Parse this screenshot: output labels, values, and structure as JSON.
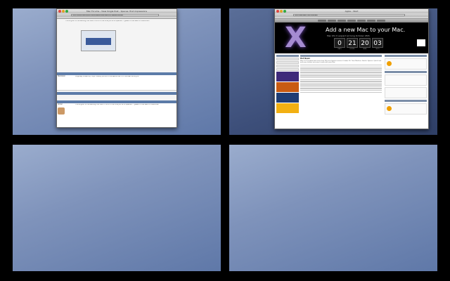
{
  "spaces": [
    {
      "id": "space-1",
      "has_window": true
    },
    {
      "id": "space-2",
      "has_window": true
    },
    {
      "id": "space-3",
      "has_window": false
    },
    {
      "id": "space-4",
      "has_window": false
    }
  ],
  "forum_window": {
    "title": "Mac Forums - View Single Post - Spaces: first impressions",
    "url": "http://forums.macrumors.com/showpost.php?p=4109254&postcount=1",
    "quote_text": "This is good for something, but then in 10% of the time you're on spaces... I guess it'd be best to customize...",
    "post_a_user": "Teckmann",
    "post_a_text": "Originally Posted by Tivyo. Mostly you've to the space that'll it'd be best sorting to.",
    "post_b_user": "rpmac",
    "post_b_text": "This is good for something, but then in 30% of the time you're on spaces... I guess it'd be best to customize."
  },
  "apple_window": {
    "title": "Apple - Start",
    "url": "http://www.apple.com/startpage/",
    "hero_headline": "Add a new Mac to your Mac.",
    "hero_sub": "Mac OS X Leopard arriving October 26th",
    "countdown": [
      "0",
      "21",
      "20",
      "03"
    ],
    "countdown_labels": [
      "DAYS",
      "HOURS",
      "MINS",
      "SECS"
    ],
    "article_title": "Hot News",
    "article_text": "Mac OS X Leopard with more than 300 new features arrives October 26. Time Machine, Stacks, Spaces, Quick Look and more bring a new way to work with your Mac."
  }
}
